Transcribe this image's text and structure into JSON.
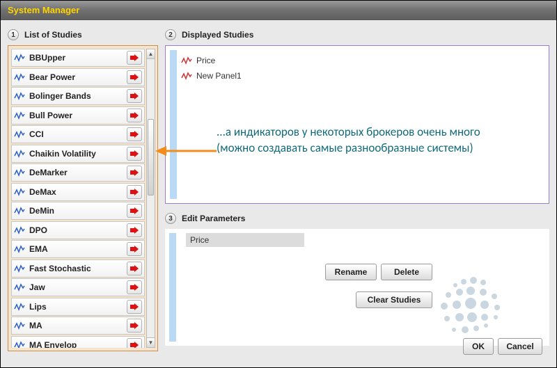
{
  "window_title": "System Manager",
  "left_panel": {
    "step": "1",
    "title": "List of Studies",
    "studies": [
      "BBUpper",
      "Bear Power",
      "Bolinger Bands",
      "Bull Power",
      "CCI",
      "Chaikin Volatility",
      "DeMarker",
      "DeMax",
      "DeMin",
      "DPO",
      "EMA",
      "Fast Stochastic",
      "Jaw",
      "Lips",
      "MA",
      "MA Envelop"
    ]
  },
  "displayed_panel": {
    "step": "2",
    "title": "Displayed Studies",
    "items": [
      "Price",
      "New Panel1"
    ]
  },
  "edit_panel": {
    "step": "3",
    "title": "Edit Parameters",
    "parameter_name": "Price"
  },
  "buttons": {
    "rename": "Rename",
    "delete": "Delete",
    "clear": "Clear Studies",
    "ok": "OK",
    "cancel": "Cancel"
  },
  "annotation": "...а индикаторов у некоторых брокеров очень много (можно создавать самые разнообразные системы)"
}
